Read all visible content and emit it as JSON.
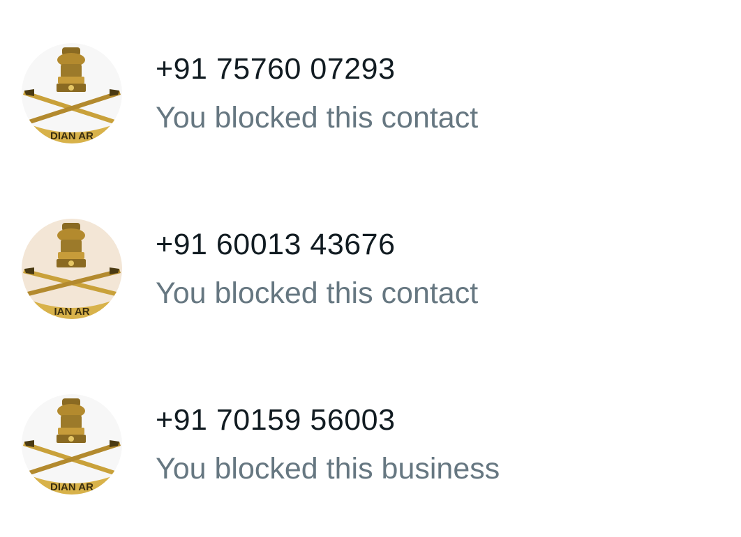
{
  "colors": {
    "background": "#ffffff",
    "title": "#111b21",
    "subtitle": "#667781",
    "emblem_gold": "#b38a2e",
    "emblem_dark": "#4a3a12"
  },
  "contacts": [
    {
      "avatar_icon": "indian-army-emblem",
      "avatar_text": "DIAN AR",
      "name": "+91 75760 07293",
      "status": "You blocked this contact",
      "avatar_bg": "#f7f7f7"
    },
    {
      "avatar_icon": "indian-army-emblem",
      "avatar_text": "IAN AR",
      "name": "+91 60013 43676",
      "status": "You blocked this contact",
      "avatar_bg": "#f3e6d6"
    },
    {
      "avatar_icon": "indian-army-emblem",
      "avatar_text": "DIAN AR",
      "name": "+91 70159 56003",
      "status": "You blocked this business",
      "avatar_bg": "#f7f7f7"
    }
  ]
}
